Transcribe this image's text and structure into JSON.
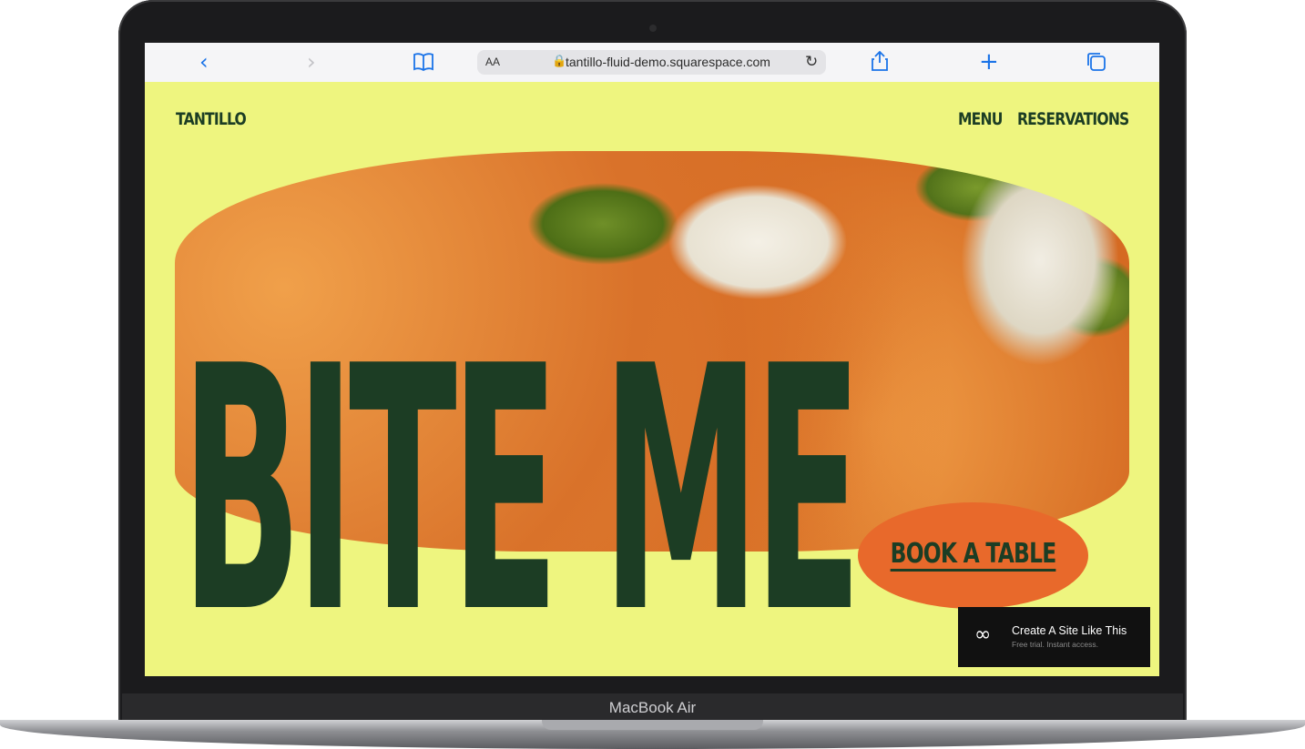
{
  "device": {
    "model_label": "MacBook Air"
  },
  "browser": {
    "url": "tantillo-fluid-demo.squarespace.com",
    "text_size_button": "AA"
  },
  "site": {
    "logo": "TANTILLO",
    "nav": [
      "MENU",
      "RESERVATIONS"
    ],
    "headline": "BITE ME",
    "cta_label": "BOOK A TABLE"
  },
  "promo": {
    "title": "Create A Site Like This",
    "subtitle": "Free trial. Instant access."
  },
  "colors": {
    "background": "#eef57f",
    "primary_text": "#1c3d24",
    "cta_bg": "#e8692b",
    "promo_bg": "#111111"
  }
}
